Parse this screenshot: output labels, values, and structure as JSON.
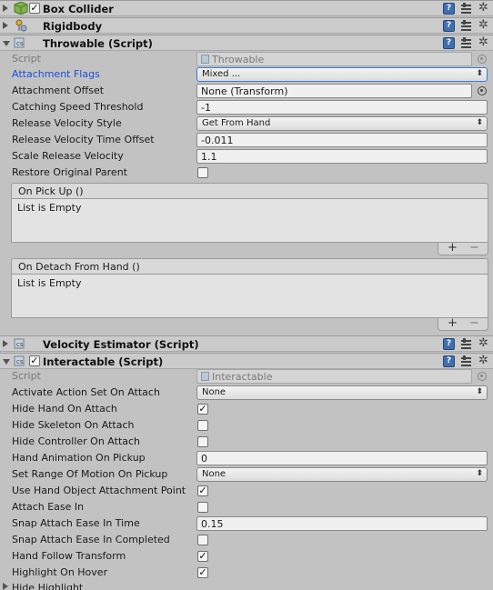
{
  "components": {
    "box_collider": {
      "title": "Box Collider",
      "enabled": true
    },
    "rigidbody": {
      "title": "Rigidbody"
    },
    "throwable": {
      "title": "Throwable (Script)"
    },
    "velocity_estimator": {
      "title": "Velocity Estimator (Script)",
      "enabled": true
    },
    "interactable": {
      "title": "Interactable (Script)",
      "enabled": true
    }
  },
  "throwable_fields": {
    "script_label": "Script",
    "script_value": "Throwable",
    "attachment_flags_label": "Attachment Flags",
    "attachment_flags_value": "Mixed ...",
    "attachment_offset_label": "Attachment Offset",
    "attachment_offset_value": "None (Transform)",
    "catching_speed_label": "Catching Speed Threshold",
    "catching_speed_value": "-1",
    "release_velocity_style_label": "Release Velocity Style",
    "release_velocity_style_value": "Get From Hand",
    "release_velocity_time_offset_label": "Release Velocity Time Offset",
    "release_velocity_time_offset_value": "-0.011",
    "scale_release_velocity_label": "Scale Release Velocity",
    "scale_release_velocity_value": "1.1",
    "restore_original_parent_label": "Restore Original Parent",
    "restore_original_parent_checked": false
  },
  "events": {
    "on_pick_up": {
      "title": "On Pick Up ()",
      "body": "List is Empty"
    },
    "on_detach": {
      "title": "On Detach From Hand ()",
      "body": "List is Empty"
    },
    "add_symbol": "+",
    "remove_symbol": "−"
  },
  "interactable_fields": {
    "script_label": "Script",
    "script_value": "Interactable",
    "activate_action_set_label": "Activate Action Set On Attach",
    "activate_action_set_value": "None",
    "hide_hand_label": "Hide Hand On Attach",
    "hide_hand_checked": true,
    "hide_skeleton_label": "Hide Skeleton On Attach",
    "hide_skeleton_checked": false,
    "hide_controller_label": "Hide Controller On Attach",
    "hide_controller_checked": false,
    "hand_animation_label": "Hand Animation On Pickup",
    "hand_animation_value": "0",
    "set_range_label": "Set Range Of Motion On Pickup",
    "set_range_value": "None",
    "use_hand_object_label": "Use Hand Object Attachment Point",
    "use_hand_object_checked": true,
    "attach_ease_in_label": "Attach Ease In",
    "attach_ease_in_checked": false,
    "snap_time_label": "Snap Attach Ease In Time",
    "snap_time_value": "0.15",
    "snap_completed_label": "Snap Attach Ease In Completed",
    "snap_completed_checked": false,
    "hand_follow_label": "Hand Follow Transform",
    "hand_follow_checked": true,
    "highlight_hover_label": "Highlight On Hover",
    "highlight_hover_checked": true,
    "hide_highlight_label": "Hide Highlight"
  },
  "icons": {
    "help": "help-book-icon",
    "presets": "presets-icon",
    "settings": "gear-icon"
  },
  "colors": {
    "accent_label": "#1d4ed8",
    "help_icon": "#3f6fb0"
  }
}
